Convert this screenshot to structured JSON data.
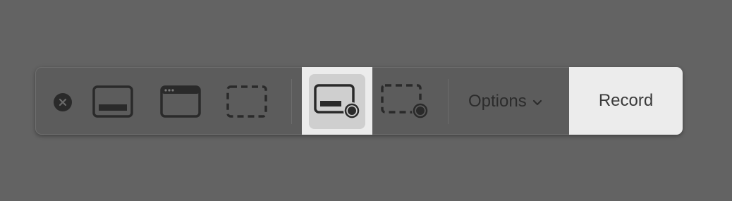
{
  "toolbar": {
    "close_icon": "close-icon",
    "buttons": [
      {
        "name": "capture-entire-screen",
        "icon": "screen-capture-icon"
      },
      {
        "name": "capture-selected-window",
        "icon": "window-capture-icon"
      },
      {
        "name": "capture-selected-portion",
        "icon": "selection-capture-icon"
      },
      {
        "name": "record-entire-screen",
        "icon": "screen-record-icon",
        "selected": true
      },
      {
        "name": "record-selected-portion",
        "icon": "selection-record-icon"
      }
    ],
    "options_label": "Options",
    "options_chevron": "chevron-down-icon",
    "record_label": "Record"
  },
  "colors": {
    "background": "#636363",
    "toolbar": "#5c5c5c",
    "icon_dark": "#2a2a2a",
    "highlight": "#ececec",
    "selected_fill": "#cfcfcf"
  }
}
